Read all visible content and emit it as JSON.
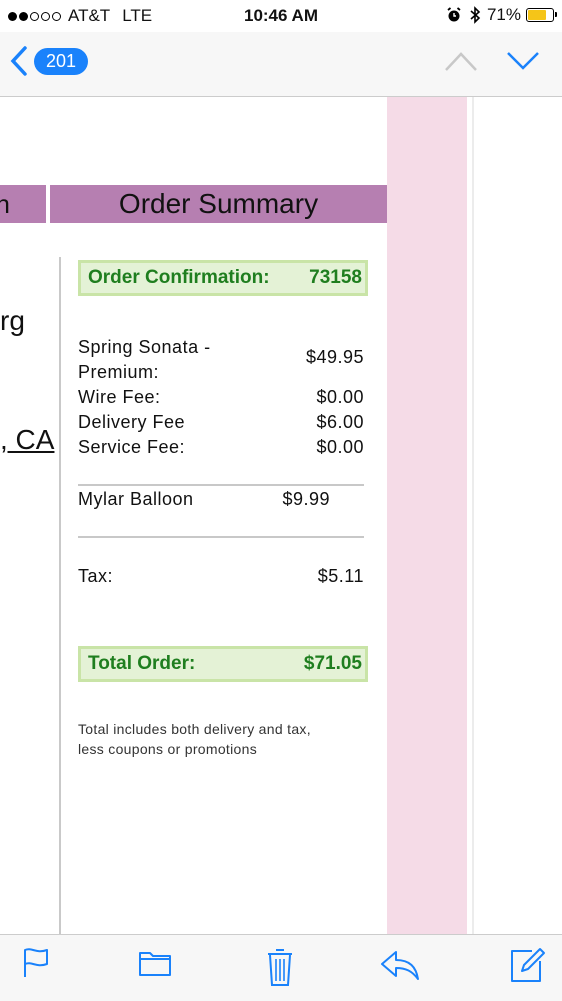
{
  "status_bar": {
    "carrier": "AT&T",
    "network": "LTE",
    "time": "10:46 AM",
    "battery": "71%",
    "signal_bars": 2,
    "battery_level": 0.71
  },
  "nav": {
    "back_count": "201"
  },
  "email": {
    "left_header_fragment": "n",
    "left_text_1": "rg",
    "left_text_2": ", CA",
    "header_title": "Order Summary",
    "confirmation_label": "Order Confirmation:",
    "confirmation_number": "73158",
    "item_line1": "Spring Sonata -",
    "item_line2": "Premium:",
    "item_price": "$49.95",
    "wire_fee_label": "Wire Fee:",
    "wire_fee": "$0.00",
    "delivery_fee_label": "Delivery Fee",
    "delivery_fee": "$6.00",
    "service_fee_label": "Service Fee:",
    "service_fee": "$0.00",
    "addon_label": "Mylar Balloon",
    "addon_price": "$9.99",
    "tax_label": "Tax:",
    "tax": "$5.11",
    "total_label": "Total Order:",
    "total": "$71.05",
    "note_line1": "Total includes both delivery and tax,",
    "note_line2": "less coupons or promotions"
  },
  "colors": {
    "accent_blue": "#1a82fb",
    "header_purple": "#b67fb1",
    "green_text": "#1f7e1f",
    "box_bg": "#e4f2d6",
    "box_border": "#c9e4a7",
    "pink_band": "#f5dbe7"
  },
  "icons": [
    "back-chevron-icon",
    "up-arrow-icon",
    "down-arrow-icon",
    "flag-icon",
    "folder-icon",
    "trash-icon",
    "reply-icon",
    "compose-icon",
    "alarm-icon",
    "bluetooth-icon",
    "battery-icon"
  ]
}
